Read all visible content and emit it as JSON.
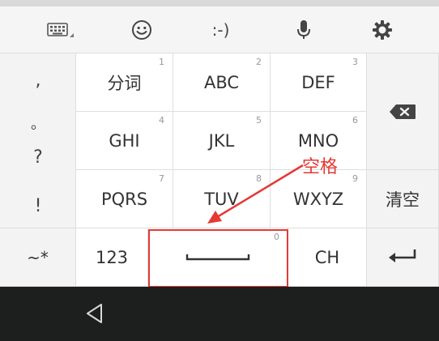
{
  "toolbar": {
    "icons": [
      "keyboard-icon",
      "emoji-icon",
      "emoticon",
      "microphone-icon",
      "settings-icon"
    ],
    "emoticon_label": ":-)"
  },
  "keyboard": {
    "left_column": [
      ",",
      "。",
      "?",
      "!"
    ],
    "symbols_key": "~*",
    "rows": [
      [
        {
          "label": "分词",
          "num": "1"
        },
        {
          "label": "ABC",
          "num": "2"
        },
        {
          "label": "DEF",
          "num": "3"
        }
      ],
      [
        {
          "label": "GHI",
          "num": "4"
        },
        {
          "label": "JKL",
          "num": "5"
        },
        {
          "label": "MNO",
          "num": "6"
        }
      ],
      [
        {
          "label": "PQRS",
          "num": "7"
        },
        {
          "label": "TUV",
          "num": "8"
        },
        {
          "label": "WXYZ",
          "num": "9"
        }
      ]
    ],
    "digits_key": "123",
    "space_num": "0",
    "ch_key": "CH",
    "clear_key": "清空",
    "delete_icon": "backspace-icon",
    "enter_icon": "enter-icon"
  },
  "annotation": {
    "label": "空格",
    "color": "#e53935"
  },
  "navbar": {
    "back_icon": "back-triangle-icon"
  }
}
